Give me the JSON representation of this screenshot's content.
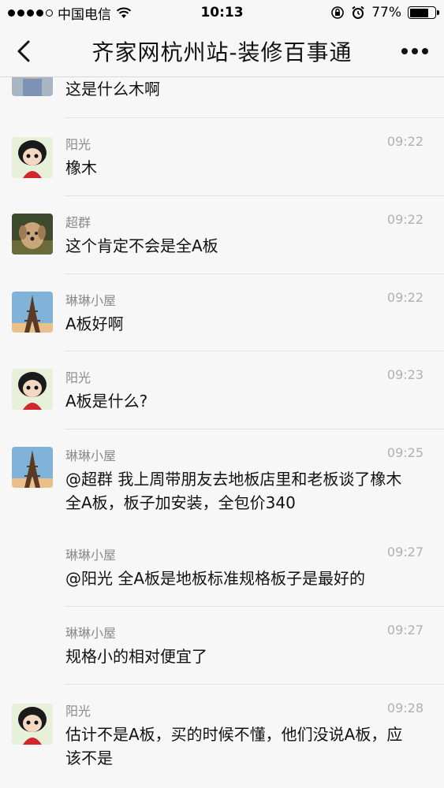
{
  "status_bar": {
    "carrier": "中国电信",
    "time": "10:13",
    "battery_text": "77%",
    "battery_level": 0.77,
    "icons": [
      "signal-dots-icon",
      "wifi-icon",
      "orientation-lock-icon",
      "alarm-icon",
      "battery-icon"
    ]
  },
  "nav": {
    "title": "齐家网杭州站-装修百事通",
    "back_icon": "chevron-left-icon",
    "more_icon": "more-dots-icon"
  },
  "messages": [
    {
      "sender": "",
      "time": "",
      "text": "这是什么木啊",
      "avatar": "person-photo"
    },
    {
      "sender": "阳光",
      "time": "09:22",
      "text": "橡木",
      "avatar": "cartoon-girl"
    },
    {
      "sender": "超群",
      "time": "09:22",
      "text": "这个肯定不会是全A板",
      "avatar": "dog-photo"
    },
    {
      "sender": "琳琳小屋",
      "time": "09:22",
      "text": "A板好啊",
      "avatar": "eiffel-tower"
    },
    {
      "sender": "阳光",
      "time": "09:23",
      "text": "A板是什么?",
      "avatar": "cartoon-girl"
    },
    {
      "sender": "琳琳小屋",
      "time": "09:25",
      "text": "@超群 我上周带朋友去地板店里和老板谈了橡木全A板，板子加安装，全包价340",
      "avatar": "eiffel-tower"
    },
    {
      "sender": "琳琳小屋",
      "time": "09:27",
      "text": "@阳光 全A板是地板标准规格板子是最好的",
      "avatar": ""
    },
    {
      "sender": "琳琳小屋",
      "time": "09:27",
      "text": "规格小的相对便宜了",
      "avatar": ""
    },
    {
      "sender": "阳光",
      "time": "09:28",
      "text": "估计不是A板，买的时候不懂，他们没说A板，应该不是",
      "avatar": "cartoon-girl"
    }
  ]
}
